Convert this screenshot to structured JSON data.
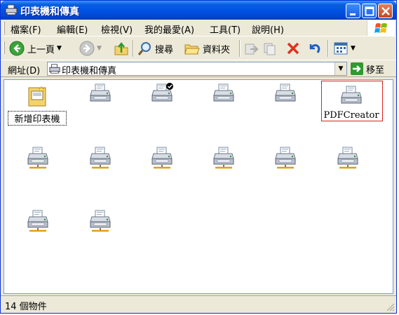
{
  "window": {
    "title": "印表機和傳真"
  },
  "menu": [
    {
      "label": "檔案(F)"
    },
    {
      "label": "編輯(E)"
    },
    {
      "label": "檢視(V)"
    },
    {
      "label": "我的最愛(A)"
    },
    {
      "label": "工具(T)"
    },
    {
      "label": "說明(H)"
    }
  ],
  "toolbar": {
    "back_label": "上一頁",
    "search_label": "搜尋",
    "folders_label": "資料夾"
  },
  "address": {
    "label": "網址(D)",
    "value": "印表機和傳真",
    "go_label": "移至"
  },
  "items": [
    {
      "label": "新增印表機",
      "icon": "add-printer-icon"
    },
    {
      "label": "",
      "icon": "printer-icon"
    },
    {
      "label": "",
      "icon": "default-printer-icon"
    },
    {
      "label": "",
      "icon": "printer-icon"
    },
    {
      "label": "",
      "icon": "printer-icon"
    },
    {
      "label": "PDFCreator",
      "icon": "printer-icon"
    },
    {
      "label": "",
      "icon": "network-printer-icon"
    },
    {
      "label": "",
      "icon": "network-printer-icon"
    },
    {
      "label": "",
      "icon": "network-printer-icon"
    },
    {
      "label": "",
      "icon": "network-printer-icon"
    },
    {
      "label": "",
      "icon": "network-printer-icon"
    },
    {
      "label": "",
      "icon": "network-printer-icon"
    },
    {
      "label": "",
      "icon": "network-printer-icon"
    },
    {
      "label": "",
      "icon": "network-printer-icon"
    }
  ],
  "status": {
    "text": "14 個物件"
  },
  "colors": {
    "titlebar": "#0054e3",
    "highlight_border": "#e02020"
  }
}
